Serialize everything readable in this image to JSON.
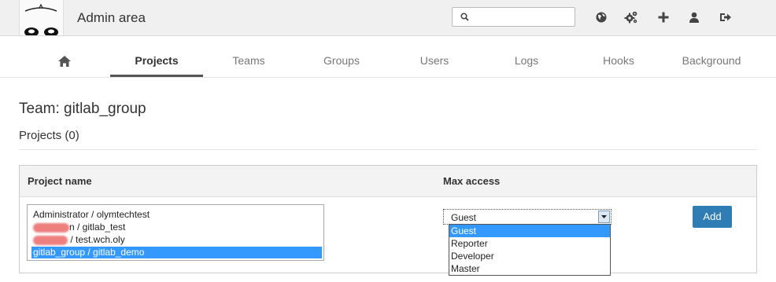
{
  "header": {
    "title": "Admin area",
    "search": {
      "placeholder": "",
      "value": ""
    },
    "icons": [
      "globe-icon",
      "gears-icon",
      "plus-icon",
      "user-icon",
      "sign-out-icon"
    ]
  },
  "nav": {
    "tabs": [
      {
        "label": "",
        "icon": "home-icon"
      },
      {
        "label": "Projects",
        "active": true
      },
      {
        "label": "Teams"
      },
      {
        "label": "Groups"
      },
      {
        "label": "Users"
      },
      {
        "label": "Logs"
      },
      {
        "label": "Hooks"
      },
      {
        "label": "Background"
      }
    ]
  },
  "main": {
    "title": "Team: gitlab_group",
    "projects_heading": "Projects (0)",
    "table": {
      "col_project": "Project name",
      "col_access": "Max access",
      "projects": [
        {
          "text": "Administrator / olymtechtest",
          "redacted_prefix": false
        },
        {
          "text": "n / gitlab_test",
          "redacted_prefix": true
        },
        {
          "text": " / test.wch.oly",
          "redacted_prefix": true
        },
        {
          "text": "gitlab_group / gitlab_demo",
          "selected": true
        }
      ],
      "access_selected": "Guest",
      "access_options": [
        "Guest",
        "Reporter",
        "Developer",
        "Master"
      ],
      "add_label": "Add"
    }
  },
  "colors": {
    "accent": "#2f7db4",
    "selection": "#3399ff",
    "redaction": "#ef8080"
  }
}
